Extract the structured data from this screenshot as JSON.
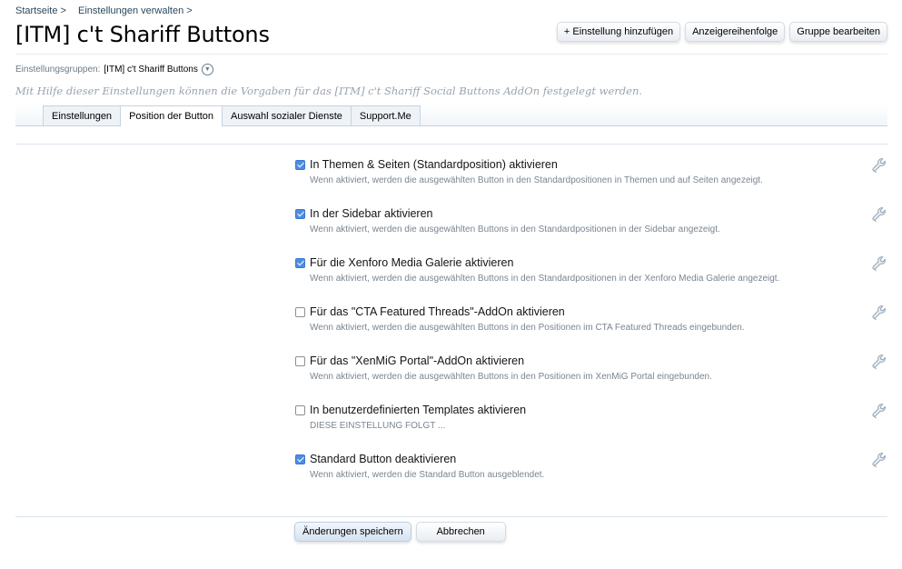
{
  "breadcrumb": {
    "home": "Startseite >",
    "settings": "Einstellungen verwalten >"
  },
  "page": {
    "title": "[ITM] c't Shariff Buttons",
    "description": "Mit Hilfe dieser Einstellungen können die Vorgaben für das [ITM] c't Shariff Social Buttons AddOn festgelegt werden."
  },
  "top_buttons": {
    "add": "+ Einstellung hinzufügen",
    "order": "Anzeigereihenfolge",
    "edit_group": "Gruppe bearbeiten"
  },
  "groups": {
    "label": "Einstellungsgruppen:",
    "value": "[ITM] c't Shariff Buttons"
  },
  "tabs": [
    {
      "label": "Einstellungen",
      "active": false
    },
    {
      "label": "Position der Button",
      "active": true
    },
    {
      "label": "Auswahl sozialer Dienste",
      "active": false
    },
    {
      "label": "Support.Me",
      "active": false
    }
  ],
  "options": [
    {
      "label": "In Themen & Seiten (Standardposition) aktivieren",
      "hint": "Wenn aktiviert, werden die ausgewählten Button in den Standardpositionen in Themen und auf Seiten angezeigt.",
      "checked": true
    },
    {
      "label": "In der Sidebar aktivieren",
      "hint": "Wenn aktiviert, werden die ausgewählten Buttons in den Standardpositionen in der Sidebar angezeigt.",
      "checked": true
    },
    {
      "label": "Für die Xenforo Media Galerie aktivieren",
      "hint": "Wenn aktiviert, werden die ausgewählten Buttons in den Standardpositionen in der Xenforo Media Galerie angezeigt.",
      "checked": true
    },
    {
      "label": "Für das \"CTA Featured Threads\"-AddOn aktivieren",
      "hint": "Wenn aktiviert, werden die ausgewählten Buttons in den Positionen im CTA Featured Threads eingebunden.",
      "checked": false
    },
    {
      "label": "Für das \"XenMiG Portal\"-AddOn aktivieren",
      "hint": "Wenn aktiviert, werden die ausgewählten Buttons in den Positionen im XenMiG Portal eingebunden.",
      "checked": false
    },
    {
      "label": "In benutzerdefinierten Templates aktivieren",
      "hint": "DIESE EINSTELLUNG FOLGT ...",
      "checked": false
    },
    {
      "label": "Standard Button deaktivieren",
      "hint": "Wenn aktiviert, werden die Standard Button ausgeblendet.",
      "checked": true
    }
  ],
  "actions": {
    "save": "Änderungen speichern",
    "cancel": "Abbrechen"
  },
  "colors": {
    "checkbox_checked": "#4a8de6",
    "link": "#2b485c",
    "hint": "#7a8590"
  },
  "icons": {
    "option_edit": "wrench-icon",
    "groups_dropdown": "chevron-down-icon"
  }
}
